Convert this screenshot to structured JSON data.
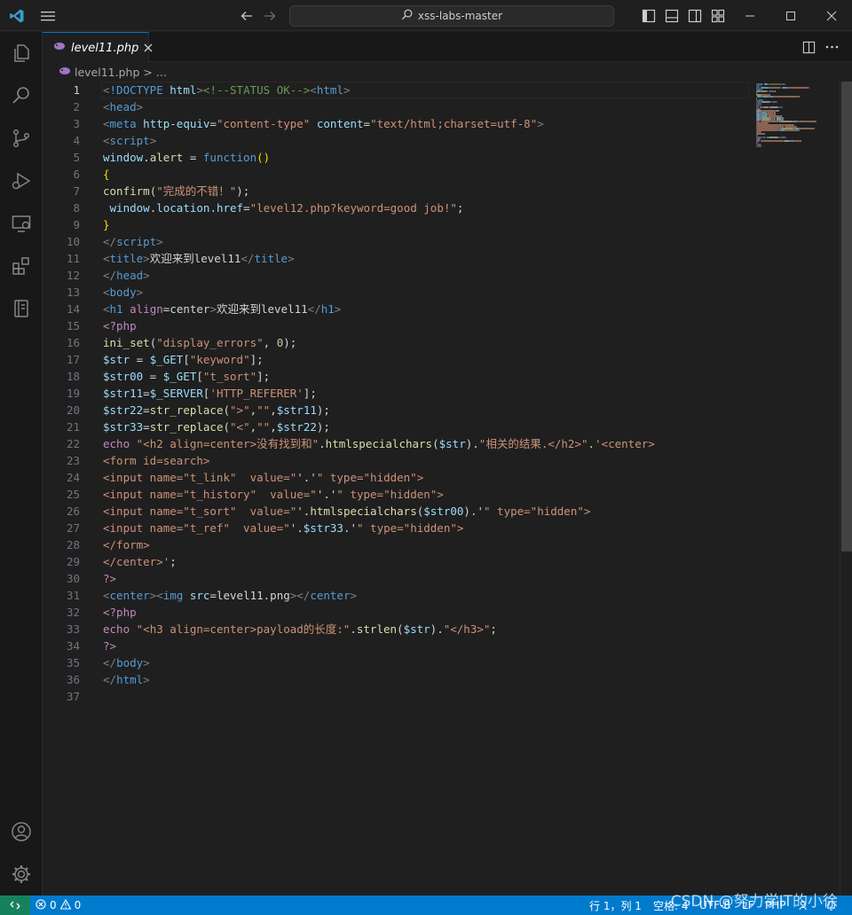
{
  "titlebar": {
    "search_text": "xss-labs-master"
  },
  "tab": {
    "label": "level11.php"
  },
  "breadcrumb": {
    "file": "level11.php",
    "separator": ">",
    "ellipsis": "..."
  },
  "editor": {
    "active_line": 1,
    "line_numbers": [
      "1",
      "2",
      "3",
      "4",
      "5",
      "6",
      "7",
      "8",
      "9",
      "10",
      "11",
      "12",
      "13",
      "14",
      "15",
      "16",
      "17",
      "18",
      "19",
      "20",
      "21",
      "22",
      "23",
      "24",
      "25",
      "26",
      "27",
      "28",
      "29",
      "30",
      "31",
      "32",
      "33",
      "34",
      "35",
      "36",
      "37"
    ],
    "lines": [
      [
        [
          "br",
          "<"
        ],
        [
          "tag",
          "!DOCTYPE"
        ],
        [
          "plain",
          " "
        ],
        [
          "attr",
          "html"
        ],
        [
          "br",
          ">"
        ],
        [
          "com",
          "<!--STATUS OK-->"
        ],
        [
          "br",
          "<"
        ],
        [
          "tag",
          "html"
        ],
        [
          "br",
          ">"
        ]
      ],
      [
        [
          "br",
          "<"
        ],
        [
          "tag",
          "head"
        ],
        [
          "br",
          ">"
        ]
      ],
      [
        [
          "br",
          "<"
        ],
        [
          "tag",
          "meta"
        ],
        [
          "plain",
          " "
        ],
        [
          "attr",
          "http-equiv"
        ],
        [
          "plain",
          "="
        ],
        [
          "str",
          "\"content-type\""
        ],
        [
          "plain",
          " "
        ],
        [
          "attr",
          "content"
        ],
        [
          "plain",
          "="
        ],
        [
          "str",
          "\"text/html;charset=utf-8\""
        ],
        [
          "br",
          ">"
        ]
      ],
      [
        [
          "br",
          "<"
        ],
        [
          "tag",
          "script"
        ],
        [
          "br",
          ">"
        ]
      ],
      [
        [
          "var",
          "window"
        ],
        [
          "plain",
          "."
        ],
        [
          "fn",
          "alert"
        ],
        [
          "plain",
          " = "
        ],
        [
          "tag",
          "function"
        ],
        [
          "brace",
          "()"
        ]
      ],
      [
        [
          "brace",
          "{"
        ]
      ],
      [
        [
          "fn",
          "confirm"
        ],
        [
          "plain",
          "("
        ],
        [
          "str",
          "\"完成的不错！\""
        ],
        [
          "plain",
          ");"
        ]
      ],
      [
        [
          "plain",
          " "
        ],
        [
          "var",
          "window"
        ],
        [
          "plain",
          "."
        ],
        [
          "var",
          "location"
        ],
        [
          "plain",
          "."
        ],
        [
          "var",
          "href"
        ],
        [
          "plain",
          "="
        ],
        [
          "str",
          "\"level12.php?keyword=good job!\""
        ],
        [
          "plain",
          ";"
        ]
      ],
      [
        [
          "brace",
          "}"
        ]
      ],
      [
        [
          "br",
          "</"
        ],
        [
          "tag",
          "script"
        ],
        [
          "br",
          ">"
        ]
      ],
      [
        [
          "br",
          "<"
        ],
        [
          "tag",
          "title"
        ],
        [
          "br",
          ">"
        ],
        [
          "plain",
          "欢迎来到level11"
        ],
        [
          "br",
          "</"
        ],
        [
          "tag",
          "title"
        ],
        [
          "br",
          ">"
        ]
      ],
      [
        [
          "br",
          "</"
        ],
        [
          "tag",
          "head"
        ],
        [
          "br",
          ">"
        ]
      ],
      [
        [
          "br",
          "<"
        ],
        [
          "tag",
          "body"
        ],
        [
          "br",
          ">"
        ]
      ],
      [
        [
          "br",
          "<"
        ],
        [
          "tag",
          "h1"
        ],
        [
          "plain",
          " "
        ],
        [
          "kw",
          "align"
        ],
        [
          "plain",
          "=center"
        ],
        [
          "br",
          ">"
        ],
        [
          "plain",
          "欢迎来到level11"
        ],
        [
          "br",
          "</"
        ],
        [
          "tag",
          "h1"
        ],
        [
          "br",
          ">"
        ]
      ],
      [
        [
          "kw",
          "<?php"
        ]
      ],
      [
        [
          "fn",
          "ini_set"
        ],
        [
          "plain",
          "("
        ],
        [
          "str",
          "\"display_errors\""
        ],
        [
          "plain",
          ", "
        ],
        [
          "num",
          "0"
        ],
        [
          "plain",
          ");"
        ]
      ],
      [
        [
          "var",
          "$str"
        ],
        [
          "plain",
          " = "
        ],
        [
          "var",
          "$_GET"
        ],
        [
          "plain",
          "["
        ],
        [
          "str",
          "\"keyword\""
        ],
        [
          "plain",
          "];"
        ]
      ],
      [
        [
          "var",
          "$str00"
        ],
        [
          "plain",
          " = "
        ],
        [
          "var",
          "$_GET"
        ],
        [
          "plain",
          "["
        ],
        [
          "str",
          "\"t_sort\""
        ],
        [
          "plain",
          "];"
        ]
      ],
      [
        [
          "var",
          "$str11"
        ],
        [
          "plain",
          "="
        ],
        [
          "var",
          "$_SERVER"
        ],
        [
          "plain",
          "["
        ],
        [
          "str",
          "'HTTP_REFERER'"
        ],
        [
          "plain",
          "];"
        ]
      ],
      [
        [
          "var",
          "$str22"
        ],
        [
          "plain",
          "="
        ],
        [
          "fn",
          "str_replace"
        ],
        [
          "plain",
          "("
        ],
        [
          "str",
          "\">\""
        ],
        [
          "plain",
          ","
        ],
        [
          "str",
          "\"\""
        ],
        [
          "plain",
          ","
        ],
        [
          "var",
          "$str11"
        ],
        [
          "plain",
          ");"
        ]
      ],
      [
        [
          "var",
          "$str33"
        ],
        [
          "plain",
          "="
        ],
        [
          "fn",
          "str_replace"
        ],
        [
          "plain",
          "("
        ],
        [
          "str",
          "\"<\""
        ],
        [
          "plain",
          ","
        ],
        [
          "str",
          "\"\""
        ],
        [
          "plain",
          ","
        ],
        [
          "var",
          "$str22"
        ],
        [
          "plain",
          ");"
        ]
      ],
      [
        [
          "kw",
          "echo"
        ],
        [
          "plain",
          " "
        ],
        [
          "str",
          "\"<h2 align=center>没有找到和\""
        ],
        [
          "plain",
          "."
        ],
        [
          "fn",
          "htmlspecialchars"
        ],
        [
          "plain",
          "("
        ],
        [
          "var",
          "$str"
        ],
        [
          "plain",
          ")."
        ],
        [
          "str",
          "\"相关的结果.</h2>\""
        ],
        [
          "plain",
          "."
        ],
        [
          "str",
          "'<center>"
        ]
      ],
      [
        [
          "str",
          "<form id=search>"
        ]
      ],
      [
        [
          "str",
          "<input name=\"t_link\"  value=\""
        ],
        [
          "plain",
          "'.'"
        ],
        [
          "str",
          "\" type=\"hidden\">"
        ]
      ],
      [
        [
          "str",
          "<input name=\"t_history\"  value=\""
        ],
        [
          "plain",
          "'.'"
        ],
        [
          "str",
          "\" type=\"hidden\">"
        ]
      ],
      [
        [
          "str",
          "<input name=\"t_sort\"  value=\""
        ],
        [
          "plain",
          "'."
        ],
        [
          "fn",
          "htmlspecialchars"
        ],
        [
          "plain",
          "("
        ],
        [
          "var",
          "$str00"
        ],
        [
          "plain",
          ").'"
        ],
        [
          "str",
          "\" type=\"hidden\">"
        ]
      ],
      [
        [
          "str",
          "<input name=\"t_ref\"  value=\""
        ],
        [
          "plain",
          "'."
        ],
        [
          "var",
          "$str33"
        ],
        [
          "plain",
          ".'"
        ],
        [
          "str",
          "\" type=\"hidden\">"
        ]
      ],
      [
        [
          "str",
          "</form>"
        ]
      ],
      [
        [
          "str",
          "</center>'"
        ],
        [
          "plain",
          ";"
        ]
      ],
      [
        [
          "kw",
          "?>"
        ]
      ],
      [
        [
          "br",
          "<"
        ],
        [
          "tag",
          "center"
        ],
        [
          "br",
          "><"
        ],
        [
          "tag",
          "img"
        ],
        [
          "plain",
          " "
        ],
        [
          "attr",
          "src"
        ],
        [
          "plain",
          "=level11.png"
        ],
        [
          "br",
          "></"
        ],
        [
          "tag",
          "center"
        ],
        [
          "br",
          ">"
        ]
      ],
      [
        [
          "kw",
          "<?php"
        ]
      ],
      [
        [
          "kw",
          "echo"
        ],
        [
          "plain",
          " "
        ],
        [
          "str",
          "\"<h3 align=center>payload的长度:\""
        ],
        [
          "plain",
          "."
        ],
        [
          "fn",
          "strlen"
        ],
        [
          "plain",
          "("
        ],
        [
          "var",
          "$str"
        ],
        [
          "plain",
          ")."
        ],
        [
          "str",
          "\"</h3>\""
        ],
        [
          "plain",
          ";"
        ]
      ],
      [
        [
          "kw",
          "?>"
        ]
      ],
      [
        [
          "br",
          "</"
        ],
        [
          "tag",
          "body"
        ],
        [
          "br",
          ">"
        ]
      ],
      [
        [
          "br",
          "</"
        ],
        [
          "tag",
          "html"
        ],
        [
          "br",
          ">"
        ]
      ],
      [
        [
          "plain",
          ""
        ]
      ]
    ]
  },
  "statusbar": {
    "errors": "0",
    "warnings": "0",
    "cursor": "行 1，列 1",
    "indent": "空格: 4",
    "encoding": "UTF-8",
    "eol": "LF",
    "language": "PHP",
    "watermark": "CSDN @努力学IT的小徐"
  },
  "colors": {
    "accent": "#0078d4",
    "statusbar": "#007acc",
    "remote": "#16825d"
  }
}
